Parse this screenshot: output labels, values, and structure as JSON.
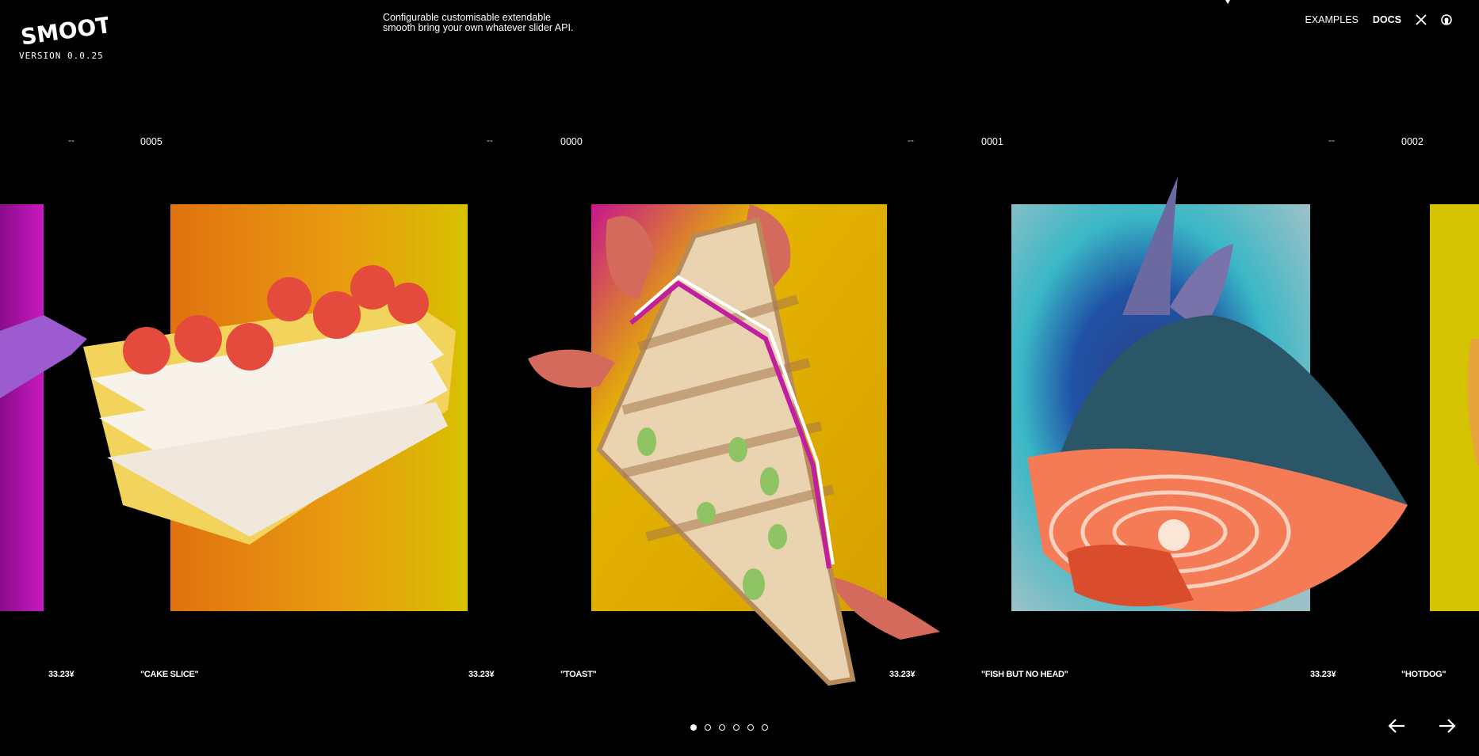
{
  "header": {
    "logo_text": "SMOOTHY",
    "version": "VERSION 0.0.25",
    "tagline_line1": "Configurable customisable extendable",
    "tagline_line2": "smooth bring your own whatever slider API.",
    "nav": {
      "examples": "EXAMPLES",
      "docs": "DOCS"
    },
    "icons": [
      "x-logo-icon",
      "github-icon"
    ]
  },
  "slides": [
    {
      "dash": "--",
      "index": "0005",
      "price": "33.23¥",
      "name": "\"CAKE SLICE\""
    },
    {
      "dash": "--",
      "index": "0000",
      "price": "33.23¥",
      "name": "\"TOAST\""
    },
    {
      "dash": "--",
      "index": "0001",
      "price": "33.23¥",
      "name": "\"FISH BUT NO HEAD\""
    },
    {
      "dash": "--",
      "index": "0002",
      "price": "33.23¥",
      "name": "\"HOTDOG\""
    }
  ],
  "pagination": {
    "count": 6,
    "active": 0
  },
  "controls": {
    "prev_icon": "arrow-left-icon",
    "next_icon": "arrow-right-icon"
  },
  "colors": {
    "background": "#000000",
    "text": "#ffffff"
  }
}
